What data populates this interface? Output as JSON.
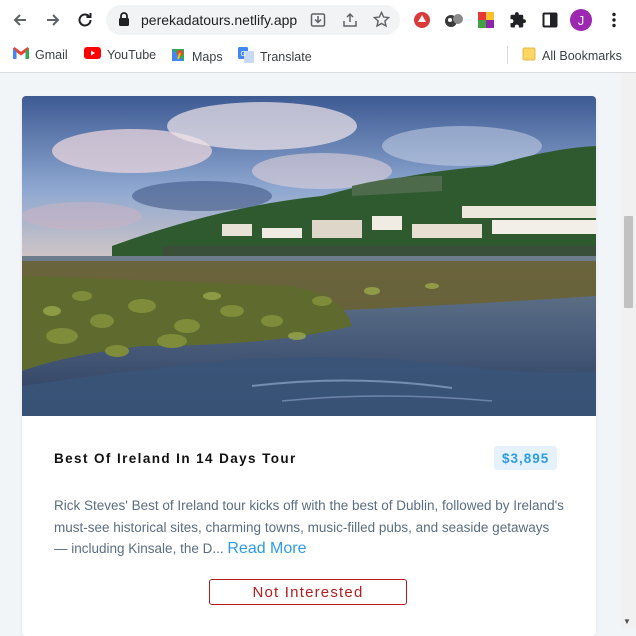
{
  "browser": {
    "url": "perekadatours.netlify.app",
    "profile_initial": "J",
    "bookmarks": [
      {
        "label": "Gmail",
        "icon": "gmail-icon"
      },
      {
        "label": "YouTube",
        "icon": "youtube-icon"
      },
      {
        "label": "Maps",
        "icon": "maps-icon"
      },
      {
        "label": "Translate",
        "icon": "translate-icon"
      }
    ],
    "all_bookmarks_label": "All Bookmarks"
  },
  "tour": {
    "title": "Best Of Ireland In 14 Days Tour",
    "price": "$3,895",
    "description": "Rick Steves' Best of Ireland tour kicks off with the best of Dublin, followed by Ireland's must-see historical sites, charming towns, music-filled pubs, and seaside getaways — including Kinsale, the D...",
    "read_more": "Read More",
    "not_interested": "Not Interested"
  },
  "colors": {
    "accent": "#2e9ce3",
    "danger": "#b31d1d",
    "page_bg": "#f1f5f8"
  }
}
